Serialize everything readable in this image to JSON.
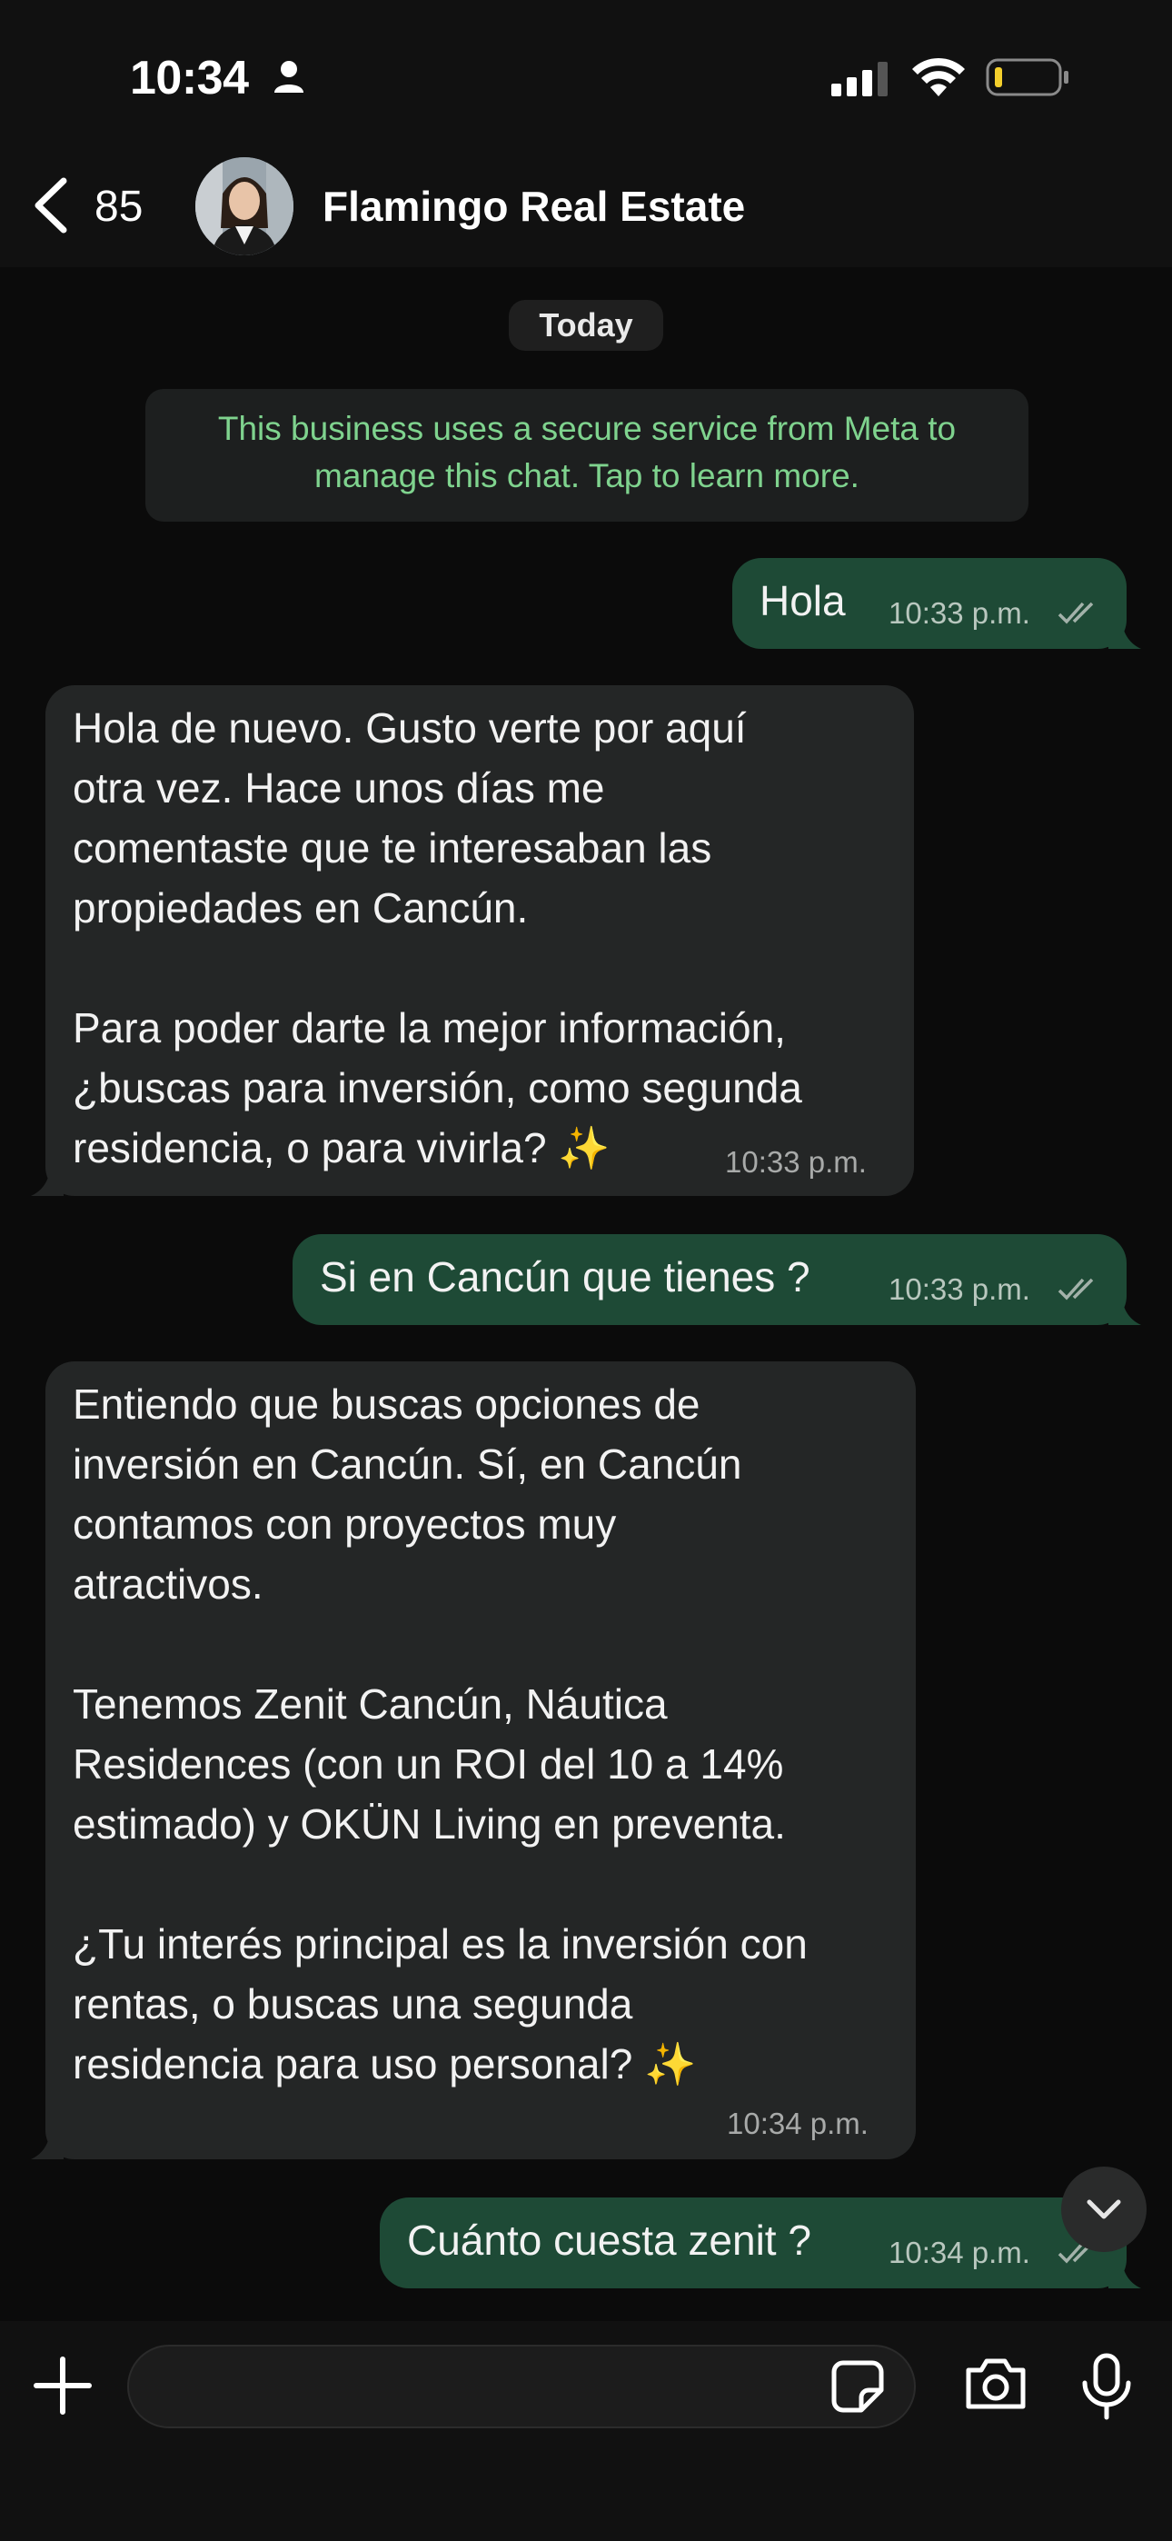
{
  "status_bar": {
    "time": "10:34"
  },
  "header": {
    "back_count": "85",
    "contact_name": "Flamingo Real Estate"
  },
  "chat": {
    "date_label": "Today",
    "meta_notice_line1": "This business uses a secure service from Meta to",
    "meta_notice_line2": "manage this chat. Tap to learn more.",
    "messages": [
      {
        "direction": "outgoing",
        "text": "Hola",
        "time": "10:33 p.m."
      },
      {
        "direction": "incoming",
        "text": "Hola de nuevo. Gusto verte por aquí\notra vez. Hace unos días me\ncomentaste que te interesaban las\npropiedades en Cancún.\n\nPara poder darte la mejor información,\n¿buscas para inversión, como segunda\nresidencia, o para vivirla? ✨",
        "time": "10:33 p.m."
      },
      {
        "direction": "outgoing",
        "text": "Si en Cancún que tienes ?",
        "time": "10:33 p.m."
      },
      {
        "direction": "incoming",
        "text": "Entiendo que buscas opciones de\ninversión en Cancún. Sí, en Cancún\ncontamos con proyectos muy\natractivos.\n\nTenemos Zenit Cancún, Náutica\nResidences (con un ROI del 10 a 14%\nestimado) y OKÜN Living en preventa.\n\n¿Tu interés principal es la inversión con\nrentas, o buscas una segunda\nresidencia para uso personal? ✨",
        "time": "10:34 p.m."
      },
      {
        "direction": "outgoing",
        "text": "Cuánto cuesta zenit ?",
        "time": "10:34 p.m."
      }
    ]
  },
  "input": {
    "placeholder": ""
  },
  "colors": {
    "outgoing_bubble": "#1e4a36",
    "incoming_bubble": "#242626",
    "meta_notice_text": "#7fd38e"
  },
  "icons": [
    "person-icon",
    "signal-icon",
    "wifi-icon",
    "battery-icon",
    "back-chevron-icon",
    "chevron-down-icon",
    "plus-icon",
    "sticker-icon",
    "camera-icon",
    "microphone-icon",
    "double-check-icon"
  ]
}
